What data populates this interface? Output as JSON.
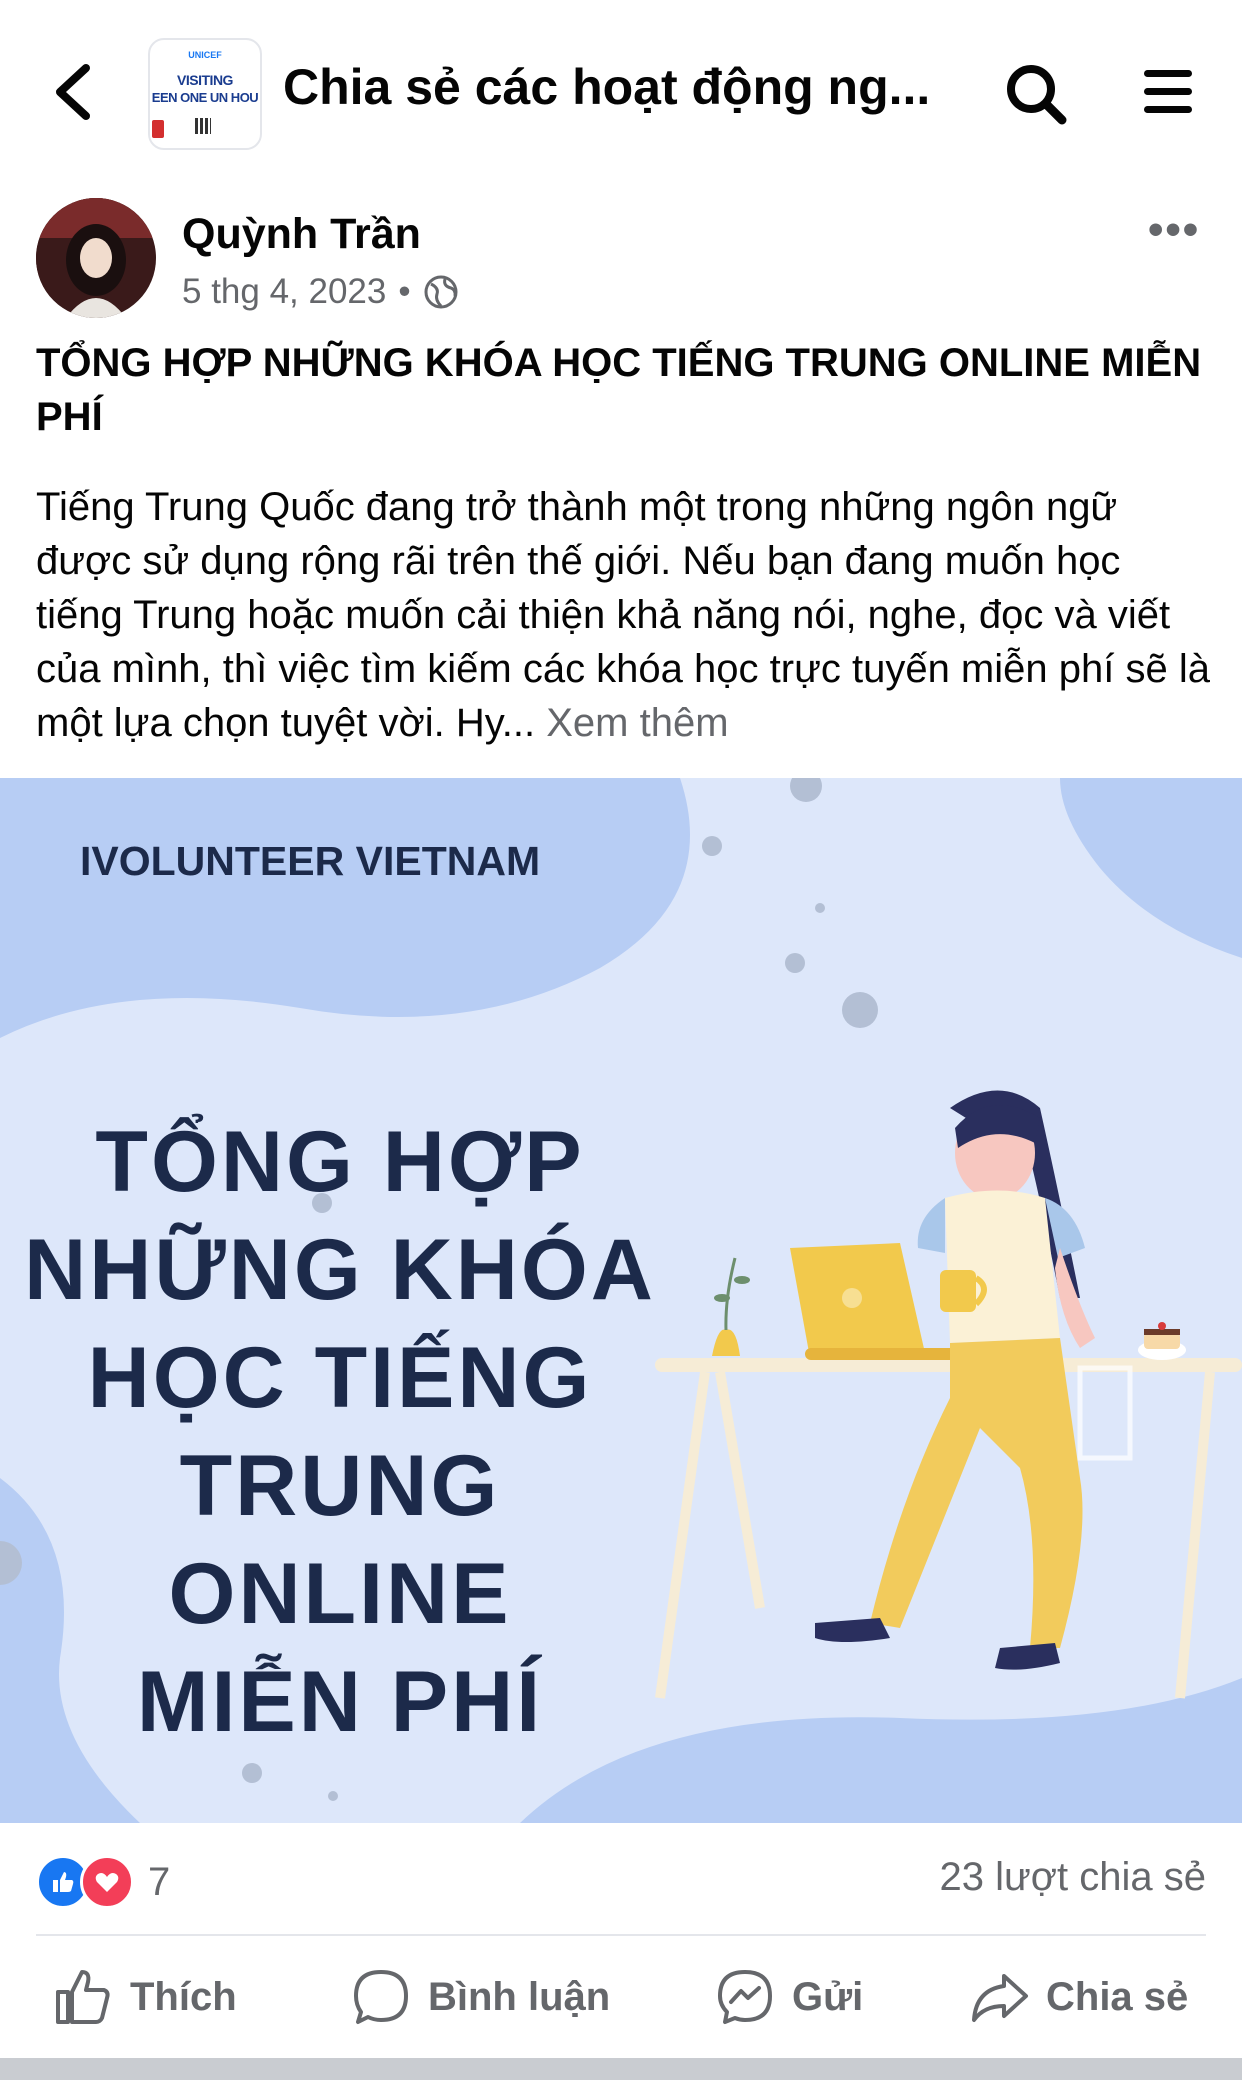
{
  "header": {
    "group_thumbnail": {
      "line1": "UNICEF",
      "line2": "VISITING",
      "line3": "EEN ONE UN HOU"
    },
    "title": "Chia sẻ các hoạt động ng...",
    "icons": {
      "back": "back-arrow-icon",
      "search": "search-icon",
      "menu": "hamburger-menu-icon"
    }
  },
  "post": {
    "author": "Quỳnh Trần",
    "date": "5 thg 4, 2023",
    "separator": "•",
    "privacy_icon": "globe-icon",
    "title": "TỔNG HỢP NHỮNG KHÓA HỌC TIẾNG TRUNG ONLINE MIỄN PHÍ",
    "body": "Tiếng Trung Quốc đang trở thành một trong những ngôn ngữ được sử dụng rộng rãi trên thế giới. Nếu bạn đang muốn học tiếng Trung hoặc muốn cải thiện khả năng nói, nghe, đọc và viết của mình, thì việc tìm kiếm các khóa học trực tuyến miễn phí sẽ là một lựa chọn tuyệt vời. Hy...",
    "see_more": "Xem thêm",
    "more_label": "•••"
  },
  "image": {
    "brand": "IVOLUNTEER VIETNAM",
    "headline_lines": [
      "TỔNG HỢP",
      "NHỮNG KHÓA",
      "HỌC TIẾNG",
      "TRUNG ONLINE",
      "MIỄN PHÍ"
    ]
  },
  "stats": {
    "reaction_count": "7",
    "shares": "23 lượt chia sẻ",
    "colors": {
      "like": "#1877f2",
      "love": "#f33e58"
    }
  },
  "actions": {
    "like": "Thích",
    "comment": "Bình luận",
    "send": "Gửi",
    "share": "Chia sẻ"
  }
}
